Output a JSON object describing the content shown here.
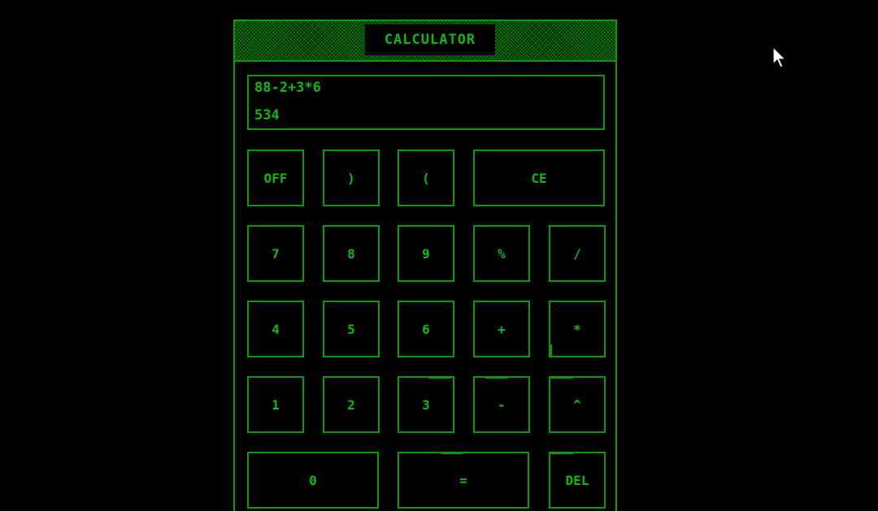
{
  "window": {
    "title": "CALCULATOR"
  },
  "display": {
    "expression": "88-2+3*6",
    "result": "534"
  },
  "keys": {
    "off": "OFF",
    "rparen": ")",
    "lparen": "(",
    "ce": "CE",
    "k7": "7",
    "k8": "8",
    "k9": "9",
    "pct": "%",
    "div": "/",
    "k4": "4",
    "k5": "5",
    "k6": "6",
    "plus": "+",
    "mul": "*",
    "k1": "1",
    "k2": "2",
    "k3": "3",
    "minus": "-",
    "pow": "^",
    "k0": "0",
    "eq": "=",
    "del": "DEL"
  },
  "colors": {
    "accent": "#13b713",
    "border": "#0a9a0a",
    "background": "#000000"
  },
  "icons": {
    "pointer": "mouse-pointer-icon"
  }
}
